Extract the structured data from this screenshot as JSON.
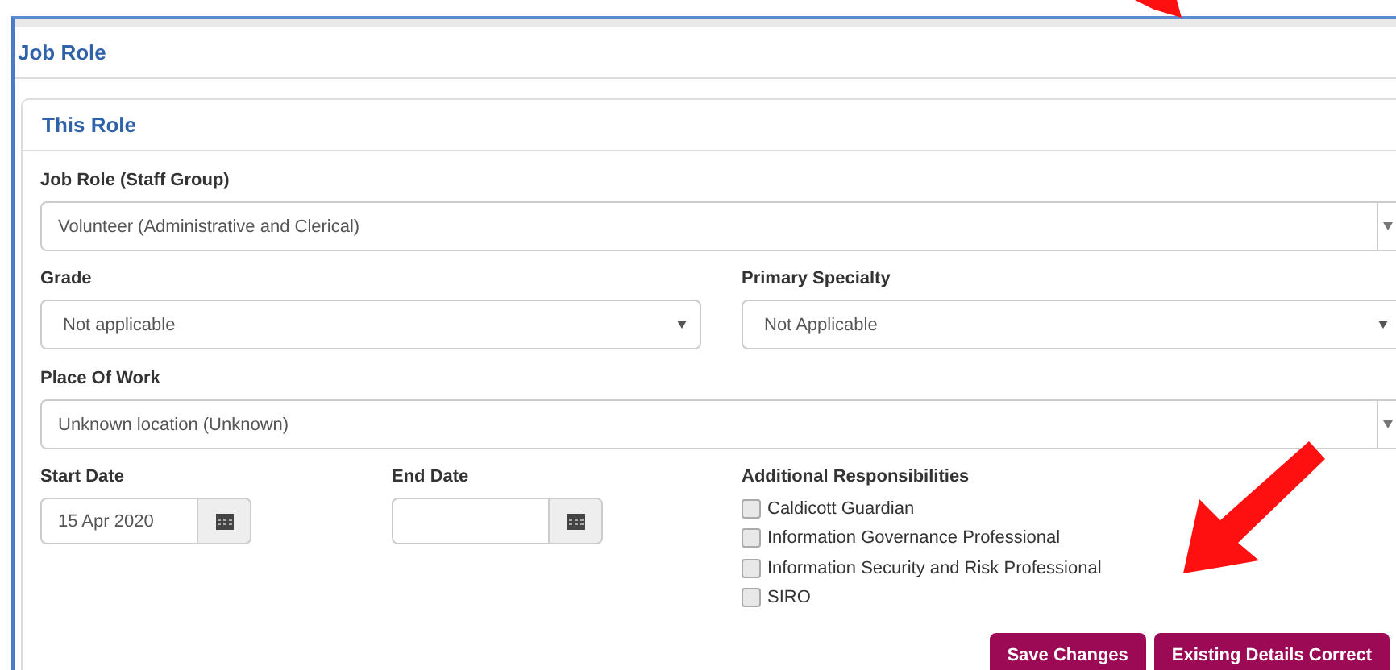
{
  "panel": {
    "title": "Job Role"
  },
  "section": {
    "title": "This Role"
  },
  "job_role": {
    "kind": "combobox",
    "label": "Job Role (Staff Group)",
    "value": "Volunteer (Administrative and Clerical)"
  },
  "grade": {
    "kind": "select",
    "label": "Grade",
    "value": "Not applicable"
  },
  "primary_specialty": {
    "kind": "select",
    "label": "Primary Specialty",
    "value": "Not Applicable"
  },
  "place_of_work": {
    "kind": "combobox",
    "label": "Place Of Work",
    "value": "Unknown location (Unknown)"
  },
  "start_date": {
    "label": "Start Date",
    "value": "15 Apr 2020"
  },
  "end_date": {
    "label": "End Date"
  },
  "additional_responsibilities": {
    "label": "Additional Responsibilities",
    "items": [
      {
        "label": "Caldicott Guardian",
        "checked": false
      },
      {
        "label": "Information Governance Professional",
        "checked": false
      },
      {
        "label": "Information Security and Risk Professional",
        "checked": false
      },
      {
        "label": "SIRO",
        "checked": false
      }
    ]
  },
  "buttons": [
    "Save Changes",
    "Existing Details Correct"
  ]
}
